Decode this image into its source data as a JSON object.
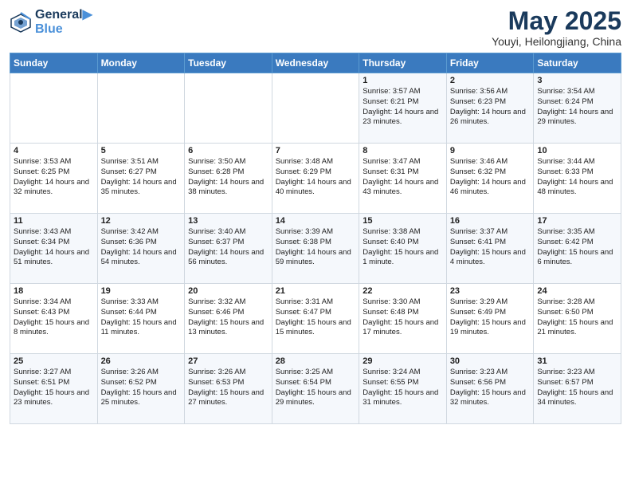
{
  "logo": {
    "line1": "General",
    "line2": "Blue"
  },
  "title": "May 2025",
  "subtitle": "Youyi, Heilongjiang, China",
  "days_header": [
    "Sunday",
    "Monday",
    "Tuesday",
    "Wednesday",
    "Thursday",
    "Friday",
    "Saturday"
  ],
  "weeks": [
    [
      {
        "day": "",
        "info": ""
      },
      {
        "day": "",
        "info": ""
      },
      {
        "day": "",
        "info": ""
      },
      {
        "day": "",
        "info": ""
      },
      {
        "day": "1",
        "info": "Sunrise: 3:57 AM\nSunset: 6:21 PM\nDaylight: 14 hours and 23 minutes."
      },
      {
        "day": "2",
        "info": "Sunrise: 3:56 AM\nSunset: 6:23 PM\nDaylight: 14 hours and 26 minutes."
      },
      {
        "day": "3",
        "info": "Sunrise: 3:54 AM\nSunset: 6:24 PM\nDaylight: 14 hours and 29 minutes."
      }
    ],
    [
      {
        "day": "4",
        "info": "Sunrise: 3:53 AM\nSunset: 6:25 PM\nDaylight: 14 hours and 32 minutes."
      },
      {
        "day": "5",
        "info": "Sunrise: 3:51 AM\nSunset: 6:27 PM\nDaylight: 14 hours and 35 minutes."
      },
      {
        "day": "6",
        "info": "Sunrise: 3:50 AM\nSunset: 6:28 PM\nDaylight: 14 hours and 38 minutes."
      },
      {
        "day": "7",
        "info": "Sunrise: 3:48 AM\nSunset: 6:29 PM\nDaylight: 14 hours and 40 minutes."
      },
      {
        "day": "8",
        "info": "Sunrise: 3:47 AM\nSunset: 6:31 PM\nDaylight: 14 hours and 43 minutes."
      },
      {
        "day": "9",
        "info": "Sunrise: 3:46 AM\nSunset: 6:32 PM\nDaylight: 14 hours and 46 minutes."
      },
      {
        "day": "10",
        "info": "Sunrise: 3:44 AM\nSunset: 6:33 PM\nDaylight: 14 hours and 48 minutes."
      }
    ],
    [
      {
        "day": "11",
        "info": "Sunrise: 3:43 AM\nSunset: 6:34 PM\nDaylight: 14 hours and 51 minutes."
      },
      {
        "day": "12",
        "info": "Sunrise: 3:42 AM\nSunset: 6:36 PM\nDaylight: 14 hours and 54 minutes."
      },
      {
        "day": "13",
        "info": "Sunrise: 3:40 AM\nSunset: 6:37 PM\nDaylight: 14 hours and 56 minutes."
      },
      {
        "day": "14",
        "info": "Sunrise: 3:39 AM\nSunset: 6:38 PM\nDaylight: 14 hours and 59 minutes."
      },
      {
        "day": "15",
        "info": "Sunrise: 3:38 AM\nSunset: 6:40 PM\nDaylight: 15 hours and 1 minute."
      },
      {
        "day": "16",
        "info": "Sunrise: 3:37 AM\nSunset: 6:41 PM\nDaylight: 15 hours and 4 minutes."
      },
      {
        "day": "17",
        "info": "Sunrise: 3:35 AM\nSunset: 6:42 PM\nDaylight: 15 hours and 6 minutes."
      }
    ],
    [
      {
        "day": "18",
        "info": "Sunrise: 3:34 AM\nSunset: 6:43 PM\nDaylight: 15 hours and 8 minutes."
      },
      {
        "day": "19",
        "info": "Sunrise: 3:33 AM\nSunset: 6:44 PM\nDaylight: 15 hours and 11 minutes."
      },
      {
        "day": "20",
        "info": "Sunrise: 3:32 AM\nSunset: 6:46 PM\nDaylight: 15 hours and 13 minutes."
      },
      {
        "day": "21",
        "info": "Sunrise: 3:31 AM\nSunset: 6:47 PM\nDaylight: 15 hours and 15 minutes."
      },
      {
        "day": "22",
        "info": "Sunrise: 3:30 AM\nSunset: 6:48 PM\nDaylight: 15 hours and 17 minutes."
      },
      {
        "day": "23",
        "info": "Sunrise: 3:29 AM\nSunset: 6:49 PM\nDaylight: 15 hours and 19 minutes."
      },
      {
        "day": "24",
        "info": "Sunrise: 3:28 AM\nSunset: 6:50 PM\nDaylight: 15 hours and 21 minutes."
      }
    ],
    [
      {
        "day": "25",
        "info": "Sunrise: 3:27 AM\nSunset: 6:51 PM\nDaylight: 15 hours and 23 minutes."
      },
      {
        "day": "26",
        "info": "Sunrise: 3:26 AM\nSunset: 6:52 PM\nDaylight: 15 hours and 25 minutes."
      },
      {
        "day": "27",
        "info": "Sunrise: 3:26 AM\nSunset: 6:53 PM\nDaylight: 15 hours and 27 minutes."
      },
      {
        "day": "28",
        "info": "Sunrise: 3:25 AM\nSunset: 6:54 PM\nDaylight: 15 hours and 29 minutes."
      },
      {
        "day": "29",
        "info": "Sunrise: 3:24 AM\nSunset: 6:55 PM\nDaylight: 15 hours and 31 minutes."
      },
      {
        "day": "30",
        "info": "Sunrise: 3:23 AM\nSunset: 6:56 PM\nDaylight: 15 hours and 32 minutes."
      },
      {
        "day": "31",
        "info": "Sunrise: 3:23 AM\nSunset: 6:57 PM\nDaylight: 15 hours and 34 minutes."
      }
    ]
  ]
}
